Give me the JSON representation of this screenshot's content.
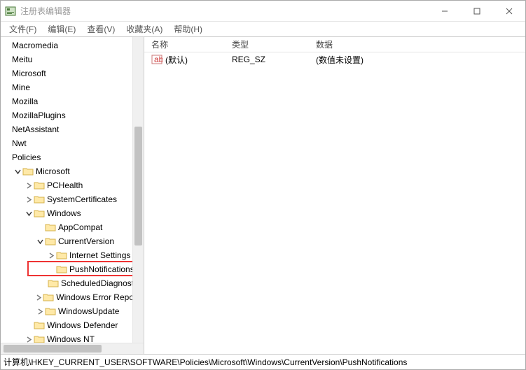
{
  "window": {
    "title": "注册表编辑器",
    "min_tip": "Minimize",
    "max_tip": "Maximize",
    "close_tip": "Close"
  },
  "menu": {
    "file": "文件(F)",
    "edit": "编辑(E)",
    "view": "查看(V)",
    "fav": "收藏夹(A)",
    "help": "帮助(H)"
  },
  "tree": {
    "items": [
      {
        "label": "Macromedia",
        "indent": 1,
        "exp": ""
      },
      {
        "label": "Meitu",
        "indent": 1,
        "exp": ""
      },
      {
        "label": "Microsoft",
        "indent": 1,
        "exp": ""
      },
      {
        "label": "Mine",
        "indent": 1,
        "exp": ""
      },
      {
        "label": "Mozilla",
        "indent": 1,
        "exp": ""
      },
      {
        "label": "MozillaPlugins",
        "indent": 1,
        "exp": ""
      },
      {
        "label": "NetAssistant",
        "indent": 1,
        "exp": ""
      },
      {
        "label": "Nwt",
        "indent": 1,
        "exp": ""
      },
      {
        "label": "Policies",
        "indent": 1,
        "exp": ""
      },
      {
        "label": "Microsoft",
        "indent": 2,
        "exp": "open",
        "icon": true
      },
      {
        "label": "PCHealth",
        "indent": 3,
        "exp": "closed",
        "icon": true
      },
      {
        "label": "SystemCertificates",
        "indent": 3,
        "exp": "closed",
        "icon": true
      },
      {
        "label": "Windows",
        "indent": 3,
        "exp": "open",
        "icon": true
      },
      {
        "label": "AppCompat",
        "indent": 4,
        "exp": "",
        "icon": true
      },
      {
        "label": "CurrentVersion",
        "indent": 4,
        "exp": "open",
        "icon": true
      },
      {
        "label": "Internet Settings",
        "indent": 5,
        "exp": "closed",
        "icon": true
      },
      {
        "label": "PushNotifications",
        "indent": 5,
        "exp": "",
        "icon": true,
        "highlighted": true
      },
      {
        "label": "ScheduledDiagnostics",
        "indent": 5,
        "exp": "",
        "icon": true
      },
      {
        "label": "Windows Error Reporti",
        "indent": 4,
        "exp": "closed",
        "icon": true
      },
      {
        "label": "WindowsUpdate",
        "indent": 4,
        "exp": "closed",
        "icon": true
      },
      {
        "label": "Windows Defender",
        "indent": 3,
        "exp": "",
        "icon": true
      },
      {
        "label": "Windows NT",
        "indent": 3,
        "exp": "closed",
        "icon": true
      }
    ]
  },
  "list": {
    "headers": {
      "name": "名称",
      "type": "类型",
      "data": "数据"
    },
    "rows": [
      {
        "name": "(默认)",
        "type": "REG_SZ",
        "data": "(数值未设置)"
      }
    ]
  },
  "status": {
    "path": "计算机\\HKEY_CURRENT_USER\\SOFTWARE\\Policies\\Microsoft\\Windows\\CurrentVersion\\PushNotifications"
  }
}
